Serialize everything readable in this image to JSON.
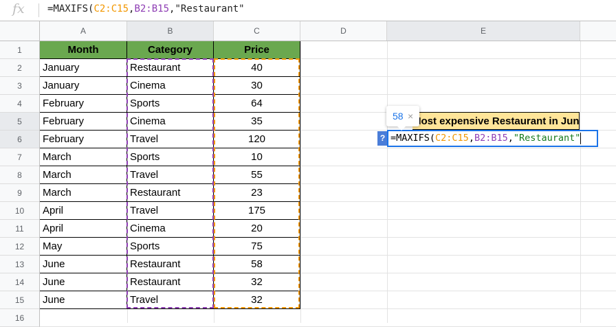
{
  "formula_bar": {
    "fx_icon": "fx-icon",
    "prefix": "=MAXIFS(",
    "range1": "C2:C15",
    "comma1": ",",
    "range2": "B2:B15",
    "comma2": ",",
    "criterion": "\"Restaurant\""
  },
  "columns": [
    "A",
    "B",
    "C",
    "D",
    "E"
  ],
  "rows": [
    "1",
    "2",
    "3",
    "4",
    "5",
    "6",
    "7",
    "8",
    "9",
    "10",
    "11",
    "12",
    "13",
    "14",
    "15",
    "16"
  ],
  "table": {
    "headers": [
      "Month",
      "Category",
      "Price"
    ],
    "data": [
      [
        "January",
        "Restaurant",
        "40"
      ],
      [
        "January",
        "Cinema",
        "30"
      ],
      [
        "February",
        "Sports",
        "64"
      ],
      [
        "February",
        "Cinema",
        "35"
      ],
      [
        "February",
        "Travel",
        "120"
      ],
      [
        "March",
        "Sports",
        "10"
      ],
      [
        "March",
        "Travel",
        "55"
      ],
      [
        "March",
        "Restaurant",
        "23"
      ],
      [
        "April",
        "Travel",
        "175"
      ],
      [
        "April",
        "Cinema",
        "20"
      ],
      [
        "May",
        "Sports",
        "75"
      ],
      [
        "June",
        "Restaurant",
        "58"
      ],
      [
        "June",
        "Restaurant",
        "32"
      ],
      [
        "June",
        "Travel",
        "32"
      ]
    ]
  },
  "e5_label": "Most expensive Restaurant in June",
  "editor": {
    "prefix": "=MAXIFS(",
    "range1": "C2:C15",
    "comma1": ",",
    "range2": "B2:B15",
    "comma2": ",",
    "criterion": "\"Restaurant\""
  },
  "preview": {
    "value": "58",
    "close": "×"
  },
  "help_label": "?",
  "colors": {
    "header_green": "#6aa84f",
    "label_yellow": "#ffe599",
    "range_purple": "#8e3db4",
    "range_orange": "#f29700",
    "editor_blue": "#1a73e8"
  }
}
